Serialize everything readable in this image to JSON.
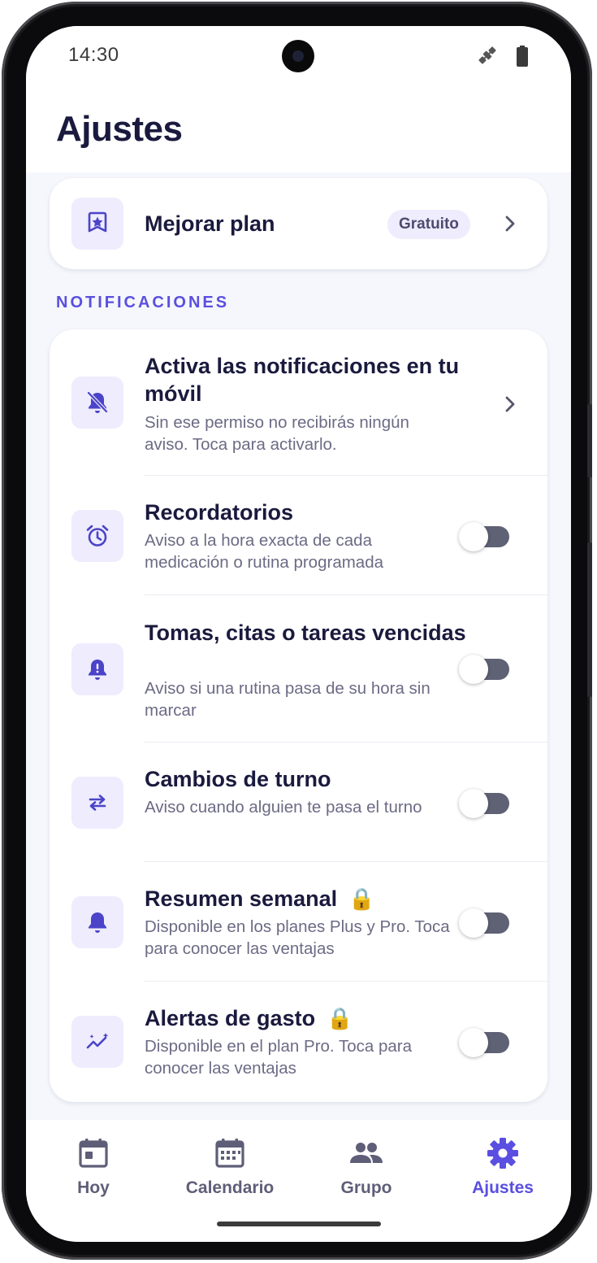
{
  "status_bar": {
    "time": "14:30",
    "icons": [
      "satellite-icon",
      "battery-icon"
    ]
  },
  "header": {
    "title": "Ajustes"
  },
  "plan": {
    "label": "Mejorar plan",
    "badge": "Gratuito",
    "icon": "award-icon"
  },
  "notifications": {
    "section_title": "NOTIFICACIONES",
    "items": [
      {
        "title": "Activa las notificaciones en tu móvil",
        "description": "Sin ese permiso no recibirás ningún aviso. Toca para activarlo.",
        "icon": "bell-off-icon",
        "control": "chevron"
      },
      {
        "title": "Recordatorios",
        "description": "Aviso a la hora exacta de cada medicación o rutina programada",
        "icon": "alarm-clock-icon",
        "control": "toggle",
        "enabled": false
      },
      {
        "title": "Tomas, citas o tareas vencidas",
        "description": "Aviso si una rutina pasa de su hora sin marcar",
        "icon": "bell-alert-icon",
        "control": "toggle",
        "enabled": false
      },
      {
        "title": "Cambios de turno",
        "description": "Aviso cuando alguien te pasa el turno",
        "icon": "swap-icon",
        "control": "toggle",
        "enabled": false
      },
      {
        "title": "Resumen semanal",
        "lock": "🔒",
        "description": "Disponible en los planes Plus y Pro. Toca para conocer las ventajas",
        "icon": "bell-icon",
        "control": "toggle",
        "enabled": false
      },
      {
        "title": "Alertas de gasto",
        "lock": "🔒",
        "description": "Disponible en el plan Pro. Toca para conocer las ventajas",
        "icon": "trend-icon",
        "control": "toggle",
        "enabled": false
      }
    ]
  },
  "bottom_nav": {
    "items": [
      {
        "label": "Hoy",
        "icon": "calendar-today-icon",
        "active": false
      },
      {
        "label": "Calendario",
        "icon": "calendar-month-icon",
        "active": false
      },
      {
        "label": "Grupo",
        "icon": "group-icon",
        "active": false
      },
      {
        "label": "Ajustes",
        "icon": "gear-icon",
        "active": true
      }
    ]
  },
  "colors": {
    "accent": "#5a4fe0",
    "icon_bg": "#eeecfd",
    "title_text": "#1a1a3e",
    "secondary_text": "#6c6b85",
    "screen_bg": "#f6f7fc",
    "toggle_off": "#5f6174"
  }
}
